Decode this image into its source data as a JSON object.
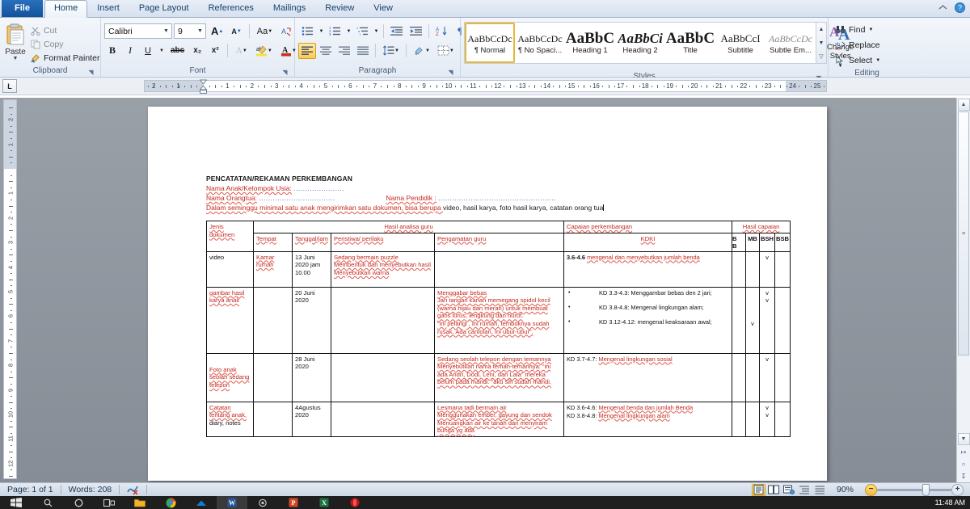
{
  "window": {
    "help_icon": "help-icon",
    "collapse_ribbon_icon": "collapse-ribbon-icon"
  },
  "tabs": [
    {
      "label": "File",
      "kind": "file"
    },
    {
      "label": "Home",
      "kind": "active"
    },
    {
      "label": "Insert",
      "kind": "normal"
    },
    {
      "label": "Page Layout",
      "kind": "normal"
    },
    {
      "label": "References",
      "kind": "normal"
    },
    {
      "label": "Mailings",
      "kind": "normal"
    },
    {
      "label": "Review",
      "kind": "normal"
    },
    {
      "label": "View",
      "kind": "normal"
    }
  ],
  "ribbon": {
    "clipboard": {
      "label": "Clipboard",
      "paste_label": "Paste",
      "items": [
        {
          "label": "Cut",
          "icon": "scissors-icon"
        },
        {
          "label": "Copy",
          "icon": "copy-icon"
        },
        {
          "label": "Format Painter",
          "icon": "format-painter-icon"
        }
      ]
    },
    "font": {
      "label": "Font",
      "font_name": "Calibri",
      "font_size": "9",
      "grow_font": "A",
      "shrink_font": "A",
      "change_case": "Aa",
      "clear_formatting": "clear-formatting-icon",
      "bold": "B",
      "italic": "I",
      "underline": "U",
      "strikethrough": "abc",
      "subscript": "x₂",
      "superscript": "x²",
      "text_effects": "A",
      "highlight": "ab",
      "font_color": "A"
    },
    "paragraph": {
      "label": "Paragraph",
      "bullets": "bullets-icon",
      "numbering": "numbering-icon",
      "multilevel": "multilevel-list-icon",
      "decrease_indent": "decrease-indent-icon",
      "increase_indent": "increase-indent-icon",
      "sort": "sort-icon",
      "show_marks": "¶",
      "align_left": "align-left-icon",
      "align_center": "align-center-icon",
      "align_right": "align-right-icon",
      "justify": "justify-icon",
      "line_spacing": "line-spacing-icon",
      "shading": "shading-icon",
      "borders": "borders-icon"
    },
    "styles": {
      "label": "Styles",
      "items": [
        {
          "preview": "AaBbCcDc",
          "name": "¶ Normal",
          "selected": true
        },
        {
          "preview": "AaBbCcDc",
          "name": "¶ No Spaci...",
          "selected": false
        },
        {
          "preview": "AaBbC",
          "name": "Heading 1",
          "selected": false
        },
        {
          "preview": "AaBbCi",
          "name": "Heading 2",
          "selected": false
        },
        {
          "preview": "AaBbC",
          "name": "Title",
          "selected": false
        },
        {
          "preview": "AaBbCcI",
          "name": "Subtitle",
          "selected": false
        },
        {
          "preview": "AaBbCcDc",
          "name": "Subtle Em...",
          "selected": false
        }
      ],
      "change_styles_line1": "Change",
      "change_styles_line2": "Styles"
    },
    "editing": {
      "label": "Editing",
      "items": [
        {
          "label": "Find",
          "icon": "binoculars-icon",
          "has_caret": true
        },
        {
          "label": "Replace",
          "icon": "replace-icon",
          "has_caret": false
        },
        {
          "label": "Select",
          "icon": "select-arrow-icon",
          "has_caret": true
        }
      ]
    }
  },
  "ruler": {
    "tab_selector": "L",
    "h_numbers_left": [
      "2",
      "1"
    ],
    "h_numbers_right": [
      "1",
      "2",
      "3",
      "4",
      "5",
      "6",
      "7",
      "8",
      "9",
      "10",
      "11",
      "12",
      "13",
      "14",
      "15",
      "16",
      "17",
      "18",
      "19",
      "20",
      "21",
      "22",
      "23",
      "24",
      "25"
    ],
    "v_numbers_top": [
      "2",
      "1"
    ],
    "v_numbers_body": [
      "1",
      "2",
      "3",
      "4",
      "5",
      "6",
      "7",
      "8",
      "9",
      "10",
      "11",
      "12",
      "13"
    ]
  },
  "document": {
    "title": "PENCATATAN/REKAMAN PERKEMBANGAN",
    "line_nama_anak_label": "Nama Anak/Kelompok Usia:",
    "line_nama_anak_dots": "......................",
    "line_nama_orangtua_label": "Nama Orangtua:",
    "line_nama_orangtua_dots": ".................................",
    "line_nama_pendidik_label": "Nama Pendidik :",
    "line_nama_pendidik_dots": "...................................................",
    "line_instruction_red": "Dalam seminggu minimal satu anak mengirimkan satu dokumen, bisa berupa ",
    "line_instruction_plain": "video, hasil karya, foto hasil karya, catatan orang tua",
    "table": {
      "header_top": {
        "jenis_dokumen": "Jenis dokumen",
        "hasil_analisa_guru": "Hasil analisa guru",
        "capaian_perkembangan": "Capaian perkembangan",
        "hasil_capaian": "Hasil capaian"
      },
      "header_sub": {
        "tempat": "Tempat",
        "tanggal_jam": "Tanggal/jam",
        "peristiwa": "Peristiwa/ perilaku",
        "pengamatan": "Pengamatan guru",
        "kdki": "KDKI",
        "bb": "BB",
        "mb": "MB",
        "bsh": "BSH",
        "bsb": "BSB"
      },
      "rows": [
        {
          "jenis": "video",
          "tempat": "Kamar rumah",
          "tanggal": "13 Juni 2020 jam 10.00",
          "peristiwa": [
            "Sedang bermain puzzle",
            "Membentuk dan menyebutkan hasil",
            "Menyebutkan warna"
          ],
          "pengamatan": [],
          "kdki_lines": [
            "3.6-4.6 mengenal dan menyebutkan jumlah benda"
          ],
          "kdki_bullets": [],
          "marks": {
            "bb": "",
            "mb": "",
            "bsh": "v",
            "bsb": ""
          },
          "extra_marks": []
        },
        {
          "jenis": "gambar hasil karya anak",
          "tempat": "",
          "tanggal": "20 Juni 2020",
          "peristiwa": [],
          "pengamatan": [
            "Menggabar bebas",
            "Jari tangan kanan memegang spidol kecil (warna hijau dan merah) untuk membuat garis lurus, lengkung dan huruf.",
            "“ini pelangi , ini rumah, temboknya sudah rusak. Ada cantolan. Ini ubur-ubur”."
          ],
          "kdki_lines": [],
          "kdki_bullets": [
            "KD 3.3-4.3: Menggambar bebas den 2 jari;",
            "KD 3.8-4.8: Mengenal lingkungan alam;",
            "KD 3.12-4.12: mengenal keaksaraan awal;"
          ],
          "marks": {
            "bb": "",
            "mb": "",
            "bsh": "v",
            "bsb": ""
          },
          "extra_marks": [
            "bsh2",
            "mb3"
          ]
        },
        {
          "jenis": "Foto anak seolah sedang telepon",
          "tempat": "",
          "tanggal": "28 Juni 2020",
          "peristiwa": [],
          "pengamatan": [
            "Sedang seolah telepon dengan temannya",
            "Menyebutkan nama teman-temannya: “ini ada Andri, Dodi, Leni, dan Lala” mereka belum pada mandi. “aku sih sudah mandi."
          ],
          "kdki_lines": [
            "KD 3.7-4.7: Mengenal lingkungan sosial"
          ],
          "kdki_bullets": [],
          "marks": {
            "bb": "",
            "mb": "",
            "bsh": "v",
            "bsb": ""
          },
          "extra_marks": []
        },
        {
          "jenis": "Catatan tentang anak, diary, notes",
          "tempat": "",
          "tanggal": "4Agustus 2020",
          "peristiwa": [],
          "pengamatan": [
            "Lesmana tadi bermain air",
            "Menggunakan ember, gayung dan sendok",
            "Menuangkan air ke tanah dan menyiram bunga yg ada"
          ],
          "kdki_lines": [
            "KD 3.6-4.6: Mengenal benda dan jumlah Benda",
            "KD 3.8-4.8: Mengenal lingkungan alam"
          ],
          "kdki_bullets": [],
          "marks": {
            "bb": "",
            "mb": "",
            "bsh": "v",
            "bsb": ""
          },
          "extra_marks": [
            "bsh2"
          ]
        }
      ]
    }
  },
  "statusbar": {
    "page": "Page: 1 of 1",
    "words": "Words: 208",
    "proofing_icon": "proofing-errors-icon",
    "zoom_level": "90%",
    "zoom_out": "−",
    "zoom_in": "+",
    "views": [
      {
        "name": "print-layout-view",
        "selected": true
      },
      {
        "name": "full-screen-reading-view",
        "selected": false
      },
      {
        "name": "web-layout-view",
        "selected": false
      },
      {
        "name": "outline-view",
        "selected": false
      },
      {
        "name": "draft-view",
        "selected": false
      }
    ]
  },
  "taskbar": {
    "time": "11:48 AM",
    "items": [
      {
        "name": "start-button",
        "color": "#dddddd"
      },
      {
        "name": "search-icon",
        "color": "#cfcfcf"
      },
      {
        "name": "cortana-icon",
        "color": "#cfcfcf"
      },
      {
        "name": "task-view-icon",
        "color": "#cfcfcf"
      },
      {
        "name": "file-explorer-icon",
        "color": "#f0b429"
      },
      {
        "name": "chrome-icon",
        "color": "#35a853"
      },
      {
        "name": "onedrive-icon",
        "color": "#0f7fd4"
      },
      {
        "name": "word-icon",
        "color": "#2b579a"
      },
      {
        "name": "photos-icon",
        "color": "#cfcfcf"
      },
      {
        "name": "powerpoint-icon",
        "color": "#d24726"
      },
      {
        "name": "excel-icon",
        "color": "#1d7044"
      },
      {
        "name": "opera-icon",
        "color": "#cc0f16"
      }
    ]
  },
  "colors": {
    "accent_blue": "#1c5fa8",
    "spelling_red": "#e05a4f",
    "doc_red_text": "#c22a1f",
    "gold_highlight": "#fdc85a"
  }
}
